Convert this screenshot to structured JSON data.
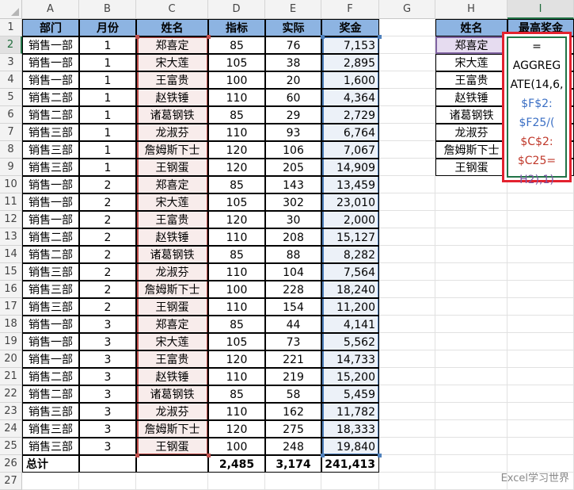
{
  "columns": [
    "A",
    "B",
    "C",
    "D",
    "E",
    "F",
    "G",
    "H",
    "I"
  ],
  "rows": [
    "1",
    "2",
    "3",
    "4",
    "5",
    "6",
    "7",
    "8",
    "9",
    "10",
    "11",
    "12",
    "13",
    "14",
    "15",
    "16",
    "17",
    "18",
    "19",
    "20",
    "21",
    "22",
    "23",
    "24",
    "25",
    "26",
    "27"
  ],
  "headers": {
    "dept": "部门",
    "month": "月份",
    "name": "姓名",
    "target": "指标",
    "actual": "实际",
    "bonus": "奖金"
  },
  "table": [
    [
      "销售一部",
      "1",
      "郑喜定",
      "85",
      "76",
      "7,153"
    ],
    [
      "销售一部",
      "1",
      "宋大莲",
      "105",
      "38",
      "2,895"
    ],
    [
      "销售一部",
      "1",
      "王富贵",
      "100",
      "20",
      "1,600"
    ],
    [
      "销售二部",
      "1",
      "赵铁锤",
      "110",
      "60",
      "4,364"
    ],
    [
      "销售二部",
      "1",
      "诸葛钢铁",
      "85",
      "29",
      "2,729"
    ],
    [
      "销售三部",
      "1",
      "龙淑芬",
      "110",
      "93",
      "6,764"
    ],
    [
      "销售三部",
      "1",
      "詹姆斯下士",
      "120",
      "106",
      "7,067"
    ],
    [
      "销售三部",
      "1",
      "王钢蛋",
      "120",
      "205",
      "14,909"
    ],
    [
      "销售一部",
      "2",
      "郑喜定",
      "85",
      "143",
      "13,459"
    ],
    [
      "销售一部",
      "2",
      "宋大莲",
      "105",
      "302",
      "23,010"
    ],
    [
      "销售一部",
      "2",
      "王富贵",
      "120",
      "30",
      "2,000"
    ],
    [
      "销售二部",
      "2",
      "赵铁锤",
      "110",
      "208",
      "15,127"
    ],
    [
      "销售二部",
      "2",
      "诸葛钢铁",
      "85",
      "88",
      "8,282"
    ],
    [
      "销售三部",
      "2",
      "龙淑芬",
      "110",
      "104",
      "7,564"
    ],
    [
      "销售三部",
      "2",
      "詹姆斯下士",
      "100",
      "228",
      "18,240"
    ],
    [
      "销售三部",
      "2",
      "王钢蛋",
      "110",
      "154",
      "11,200"
    ],
    [
      "销售一部",
      "3",
      "郑喜定",
      "85",
      "44",
      "4,141"
    ],
    [
      "销售一部",
      "3",
      "宋大莲",
      "105",
      "73",
      "5,562"
    ],
    [
      "销售一部",
      "3",
      "王富贵",
      "120",
      "221",
      "14,733"
    ],
    [
      "销售二部",
      "3",
      "赵铁锤",
      "110",
      "219",
      "15,200"
    ],
    [
      "销售二部",
      "3",
      "诸葛钢铁",
      "85",
      "58",
      "5,459"
    ],
    [
      "销售三部",
      "3",
      "龙淑芬",
      "110",
      "162",
      "11,782"
    ],
    [
      "销售三部",
      "3",
      "詹姆斯下士",
      "120",
      "275",
      "18,333"
    ],
    [
      "销售三部",
      "3",
      "王钢蛋",
      "100",
      "248",
      "19,840"
    ]
  ],
  "total": {
    "label": "总计",
    "target": "2,485",
    "actual": "3,174",
    "bonus": "241,413"
  },
  "lookup": {
    "name_header": "姓名",
    "bonus_header": "最高奖金",
    "names": [
      "郑喜定",
      "宋大莲",
      "王富贵",
      "赵铁锤",
      "诸葛钢铁",
      "龙淑芬",
      "詹姆斯下士",
      "王钢蛋"
    ]
  },
  "formula_tokens": [
    {
      "text": "=",
      "color": "#000000"
    },
    {
      "text": "AGGREG",
      "color": "#000000"
    },
    {
      "text": "ATE(14,6,",
      "color": "#000000"
    },
    {
      "text": "$F$2:",
      "color": "#3b6fc4"
    },
    {
      "text": "$F25/(",
      "color": "#3b6fc4"
    },
    {
      "text": "$C$2:",
      "color": "#c0392b"
    },
    {
      "text": "$C25=",
      "color": "#c0392b"
    },
    {
      "text": "H2),1)",
      "color": "#7b5aa6"
    }
  ],
  "watermark": "Excel学习世界",
  "colors": {
    "header_fill": "#8db4e2",
    "range_red": "#c0504d",
    "range_blue": "#4f81bd",
    "range_purple": "#8064a2",
    "callout": "#e3222f",
    "active": "#217346"
  }
}
